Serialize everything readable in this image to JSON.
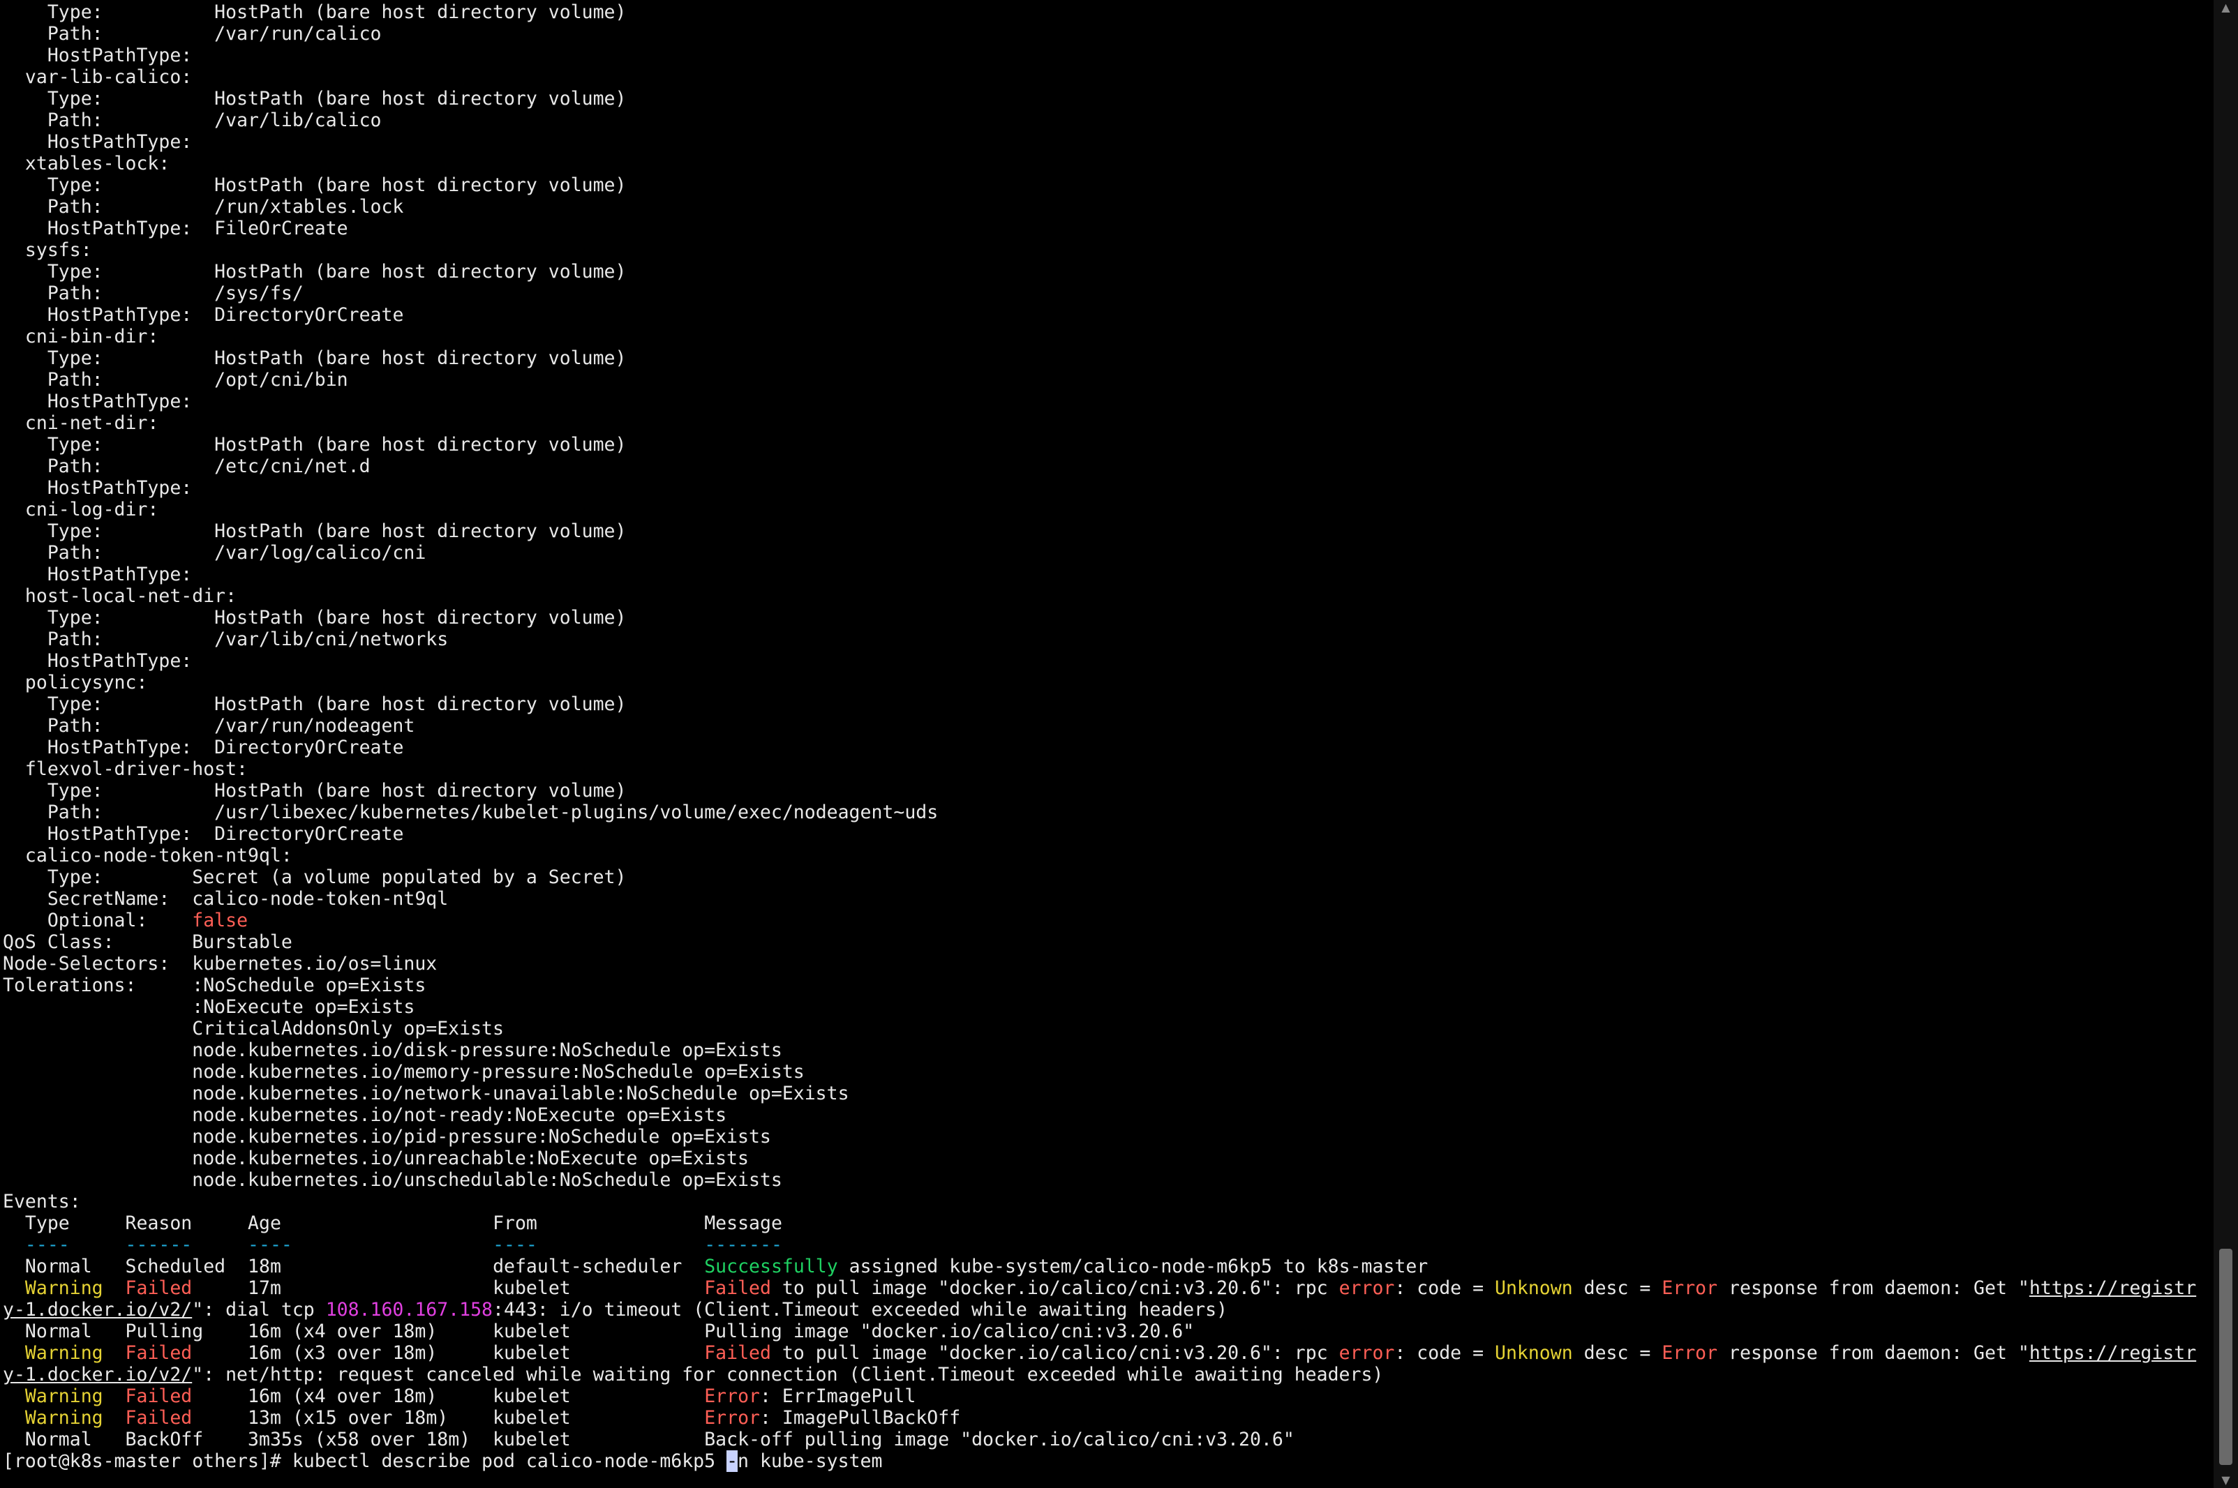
{
  "volumes": [
    {
      "name": "",
      "type": "HostPath (bare host directory volume)",
      "path": "/var/run/calico",
      "host_path_type": ""
    },
    {
      "name": "var-lib-calico:",
      "type": "HostPath (bare host directory volume)",
      "path": "/var/lib/calico",
      "host_path_type": ""
    },
    {
      "name": "xtables-lock:",
      "type": "HostPath (bare host directory volume)",
      "path": "/run/xtables.lock",
      "host_path_type": "FileOrCreate"
    },
    {
      "name": "sysfs:",
      "type": "HostPath (bare host directory volume)",
      "path": "/sys/fs/",
      "host_path_type": "DirectoryOrCreate"
    },
    {
      "name": "cni-bin-dir:",
      "type": "HostPath (bare host directory volume)",
      "path": "/opt/cni/bin",
      "host_path_type": ""
    },
    {
      "name": "cni-net-dir:",
      "type": "HostPath (bare host directory volume)",
      "path": "/etc/cni/net.d",
      "host_path_type": ""
    },
    {
      "name": "cni-log-dir:",
      "type": "HostPath (bare host directory volume)",
      "path": "/var/log/calico/cni",
      "host_path_type": ""
    },
    {
      "name": "host-local-net-dir:",
      "type": "HostPath (bare host directory volume)",
      "path": "/var/lib/cni/networks",
      "host_path_type": ""
    },
    {
      "name": "policysync:",
      "type": "HostPath (bare host directory volume)",
      "path": "/var/run/nodeagent",
      "host_path_type": "DirectoryOrCreate"
    },
    {
      "name": "flexvol-driver-host:",
      "type": "HostPath (bare host directory volume)",
      "path": "/usr/libexec/kubernetes/kubelet-plugins/volume/exec/nodeagent~uds",
      "host_path_type": "DirectoryOrCreate"
    }
  ],
  "labels": {
    "type": "Type:",
    "path": "Path:",
    "host_path_type": "HostPathType:",
    "secret_name": "SecretName:",
    "optional": "Optional:",
    "qos_class": "QoS Class:",
    "node_selectors": "Node-Selectors:",
    "tolerations": "Tolerations:",
    "events": "Events:"
  },
  "secret_volume": {
    "name": "calico-node-token-nt9ql:",
    "type": "Secret (a volume populated by a Secret)",
    "secret_name": "calico-node-token-nt9ql",
    "optional": "false"
  },
  "qos_class": "Burstable",
  "node_selectors": "kubernetes.io/os=linux",
  "tolerations": [
    ":NoSchedule op=Exists",
    ":NoExecute op=Exists",
    "CriticalAddonsOnly op=Exists",
    "node.kubernetes.io/disk-pressure:NoSchedule op=Exists",
    "node.kubernetes.io/memory-pressure:NoSchedule op=Exists",
    "node.kubernetes.io/network-unavailable:NoSchedule op=Exists",
    "node.kubernetes.io/not-ready:NoExecute op=Exists",
    "node.kubernetes.io/pid-pressure:NoSchedule op=Exists",
    "node.kubernetes.io/unreachable:NoExecute op=Exists",
    "node.kubernetes.io/unschedulable:NoSchedule op=Exists"
  ],
  "events_table": {
    "headers": [
      "Type",
      "Reason",
      "Age",
      "From",
      "Message"
    ],
    "separators": [
      "----",
      "------",
      "----",
      "----",
      "-------"
    ],
    "rows": [
      {
        "type": "Normal",
        "reason": "Scheduled",
        "age": "18m",
        "from": "default-scheduler",
        "message": [
          {
            "t": "Successfully",
            "s": "g"
          },
          {
            "t": " assigned kube-system/calico-node-m6kp5 to k8s-master"
          }
        ]
      },
      {
        "type": "Warning",
        "reason": "Failed",
        "age": "17m",
        "from": "kubelet",
        "message": [
          {
            "t": "Failed",
            "s": "r"
          },
          {
            "t": " to pull image \"docker.io/calico/cni:v3.20.6\": rpc "
          },
          {
            "t": "error",
            "s": "r"
          },
          {
            "t": ": code = "
          },
          {
            "t": "Unknown",
            "s": "y"
          },
          {
            "t": " desc = "
          },
          {
            "t": "Error",
            "s": "r"
          },
          {
            "t": " response from daemon: Get \""
          },
          {
            "t": "https://registr",
            "s": "u"
          }
        ],
        "wrap": [
          {
            "t": "y-1.docker.io/v2/",
            "s": "u"
          },
          {
            "t": "\": dial tcp "
          },
          {
            "t": "108.160.167.158",
            "s": "m"
          },
          {
            "t": ":443: i/o timeout (Client.Timeout exceeded while awaiting headers)"
          }
        ]
      },
      {
        "type": "Normal",
        "reason": "Pulling",
        "age": "16m (x4 over 18m)",
        "from": "kubelet",
        "message": [
          {
            "t": "Pulling image \"docker.io/calico/cni:v3.20.6\""
          }
        ]
      },
      {
        "type": "Warning",
        "reason": "Failed",
        "age": "16m (x3 over 18m)",
        "from": "kubelet",
        "message": [
          {
            "t": "Failed",
            "s": "r"
          },
          {
            "t": " to pull image \"docker.io/calico/cni:v3.20.6\": rpc "
          },
          {
            "t": "error",
            "s": "r"
          },
          {
            "t": ": code = "
          },
          {
            "t": "Unknown",
            "s": "y"
          },
          {
            "t": " desc = "
          },
          {
            "t": "Error",
            "s": "r"
          },
          {
            "t": " response from daemon: Get \""
          },
          {
            "t": "https://registr",
            "s": "u"
          }
        ],
        "wrap": [
          {
            "t": "y-1.docker.io/v2/",
            "s": "u"
          },
          {
            "t": "\": net/http: request canceled while waiting for connection (Client.Timeout exceeded while awaiting headers)"
          }
        ]
      },
      {
        "type": "Warning",
        "reason": "Failed",
        "age": "16m (x4 over 18m)",
        "from": "kubelet",
        "message": [
          {
            "t": "Error",
            "s": "r"
          },
          {
            "t": ": ErrImagePull"
          }
        ]
      },
      {
        "type": "Warning",
        "reason": "Failed",
        "age": "13m (x15 over 18m)",
        "from": "kubelet",
        "message": [
          {
            "t": "Error",
            "s": "r"
          },
          {
            "t": ": ImagePullBackOff"
          }
        ]
      },
      {
        "type": "Normal",
        "reason": "BackOff",
        "age": "3m35s (x58 over 18m)",
        "from": "kubelet",
        "message": [
          {
            "t": "Back-off pulling image \"docker.io/calico/cni:v3.20.6\""
          }
        ]
      }
    ]
  },
  "prompt": {
    "text": "[root@k8s-master others]# ",
    "command_before_cursor": "kubectl describe pod calico-node-m6kp5 ",
    "cursor_char": "-",
    "command_after_cursor": "n kube-system"
  },
  "colors": {
    "background": "#000000",
    "foreground": "#e8e8e8",
    "green": "#1fd162",
    "yellow": "#e5d234",
    "red": "#ff5f56",
    "cyan": "#1ea7d6",
    "magenta": "#e040e0"
  }
}
